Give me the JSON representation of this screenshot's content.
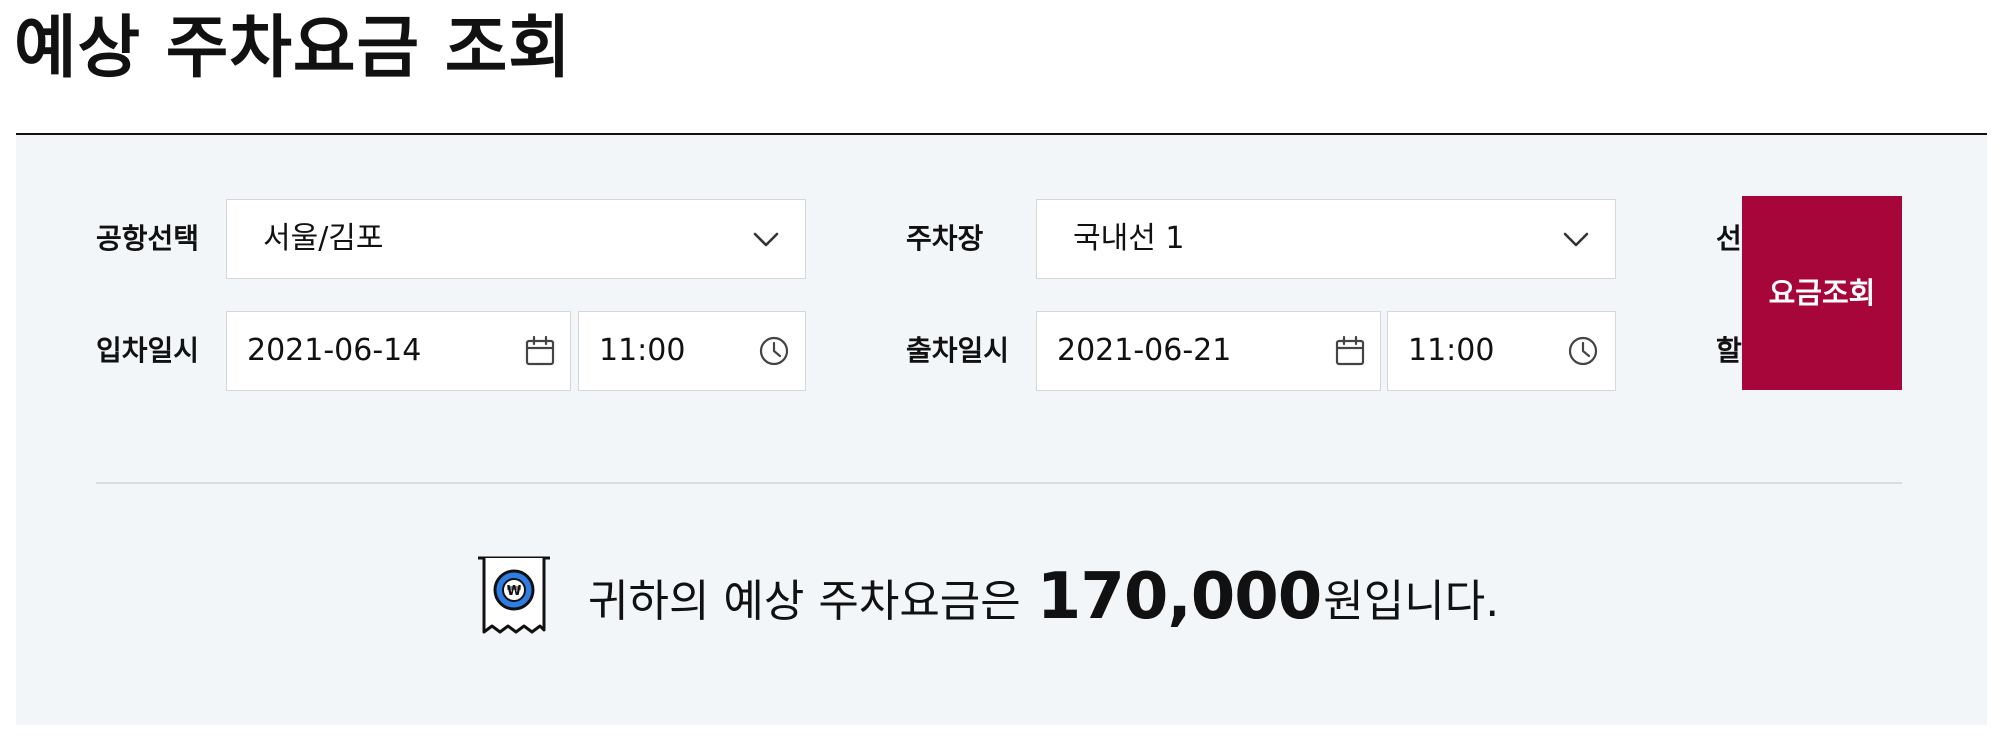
{
  "page": {
    "title": "예상 주차요금 조회"
  },
  "form": {
    "airport": {
      "label": "공항선택",
      "value": "서울/김포"
    },
    "parking_lot": {
      "label": "주차장",
      "value": "국내선 1"
    },
    "selection_label_partial": "선",
    "entry": {
      "label": "입차일시",
      "date": "2021-06-14",
      "time": "11:00"
    },
    "exit": {
      "label": "출차일시",
      "date": "2021-06-21",
      "time": "11:00"
    },
    "discount_label_partial": "할",
    "search_button": "요금조회"
  },
  "result": {
    "prefix": "귀하의 예상 주차요금은",
    "amount": "170,000",
    "suffix": "원입니다."
  },
  "colors": {
    "accent": "#a6063a",
    "panel_bg": "#f3f6f9",
    "border": "#d4d7dc",
    "icon_blue": "#2f7de1"
  },
  "icons": {
    "dropdown": "chevron-down-icon",
    "date": "calendar-icon",
    "time": "clock-icon",
    "result": "won-receipt-icon"
  }
}
